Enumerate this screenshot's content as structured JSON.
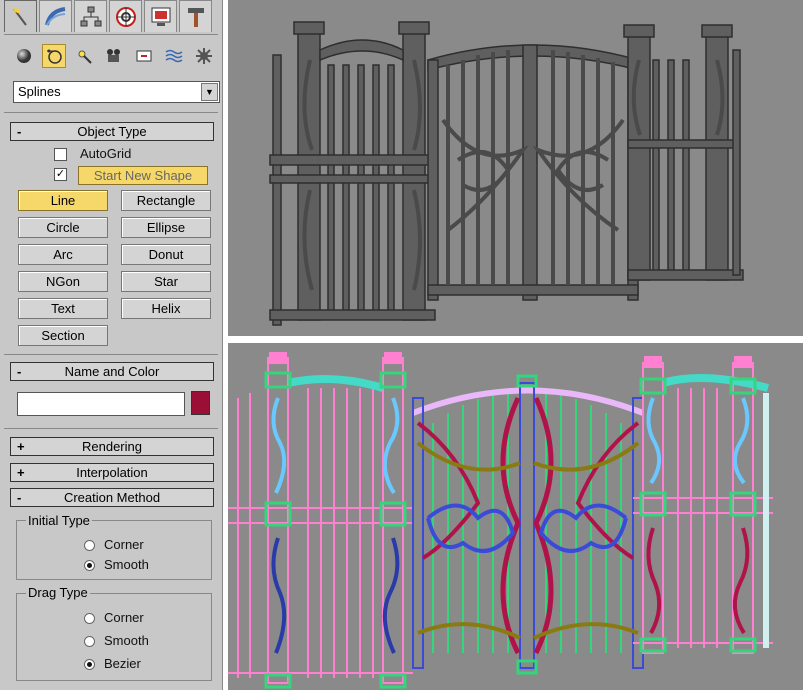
{
  "tabs": [
    {
      "icon": "create-icon"
    },
    {
      "icon": "modify-icon"
    },
    {
      "icon": "hierarchy-icon"
    },
    {
      "icon": "motion-icon"
    },
    {
      "icon": "display-icon"
    },
    {
      "icon": "utilities-icon"
    }
  ],
  "subtabs": [
    {
      "icon": "geometry-icon"
    },
    {
      "icon": "shapes-icon"
    },
    {
      "icon": "lights-icon"
    },
    {
      "icon": "cameras-icon"
    },
    {
      "icon": "helpers-icon"
    },
    {
      "icon": "space-warps-icon"
    },
    {
      "icon": "systems-icon"
    }
  ],
  "category_dropdown": {
    "value": "Splines"
  },
  "object_type": {
    "title": "Object Type",
    "sign": "-",
    "autogrid_label": "AutoGrid",
    "autogrid_checked": false,
    "start_new_shape_label": "Start New Shape",
    "start_new_shape_checked": true,
    "buttons": [
      "Line",
      "Rectangle",
      "Circle",
      "Ellipse",
      "Arc",
      "Donut",
      "NGon",
      "Star",
      "Text",
      "Helix",
      "Section"
    ],
    "active_button": "Line"
  },
  "name_and_color": {
    "title": "Name and Color",
    "sign": "-",
    "name_value": "",
    "color": "#9b0f37"
  },
  "rendering": {
    "title": "Rendering",
    "sign": "+"
  },
  "interpolation": {
    "title": "Interpolation",
    "sign": "+"
  },
  "creation_method": {
    "title": "Creation Method",
    "sign": "-",
    "initial_type": {
      "title": "Initial Type",
      "options": [
        "Corner",
        "Smooth"
      ],
      "selected": "Smooth"
    },
    "drag_type": {
      "title": "Drag Type",
      "options": [
        "Corner",
        "Smooth",
        "Bezier"
      ],
      "selected": "Bezier"
    }
  },
  "colors": {
    "panel_bg": "#c8c8c8",
    "active_yellow": "#f6d86a",
    "viewport_bg": "#8a8a8a",
    "wire_pink": "#ff7fd0",
    "wire_green": "#33d67a",
    "wire_blue": "#3a4bd8",
    "wire_red": "#b0124a",
    "wire_olive": "#8a7a12",
    "wire_cyan": "#45d9c8"
  }
}
